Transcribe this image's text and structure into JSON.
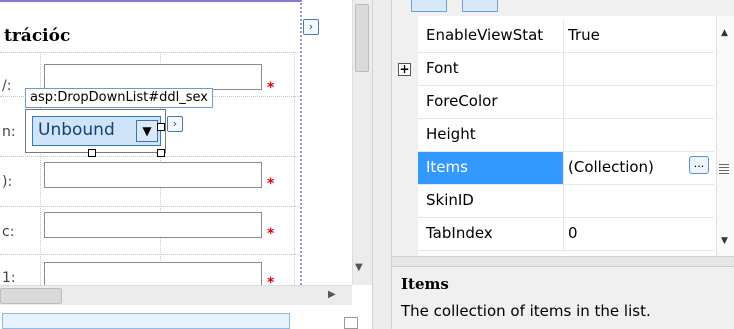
{
  "designer": {
    "page_title": "trációc",
    "row_labels": [
      "/:",
      "n:",
      "):",
      "c:",
      "1:"
    ],
    "required_mark": "*",
    "control_label": "asp:DropDownList#ddl_sex",
    "dropdown_value": "Unbound",
    "dropdown_arrow": "▼",
    "smart_tag_glyph": "›"
  },
  "property_grid": {
    "rows": [
      {
        "name": "EnableViewStat",
        "value": "True"
      },
      {
        "name": "Font",
        "value": "",
        "expand": "+"
      },
      {
        "name": "ForeColor",
        "value": ""
      },
      {
        "name": "Height",
        "value": ""
      },
      {
        "name": "Items",
        "value": "(Collection)",
        "selected": true
      },
      {
        "name": "SkinID",
        "value": ""
      },
      {
        "name": "TabIndex",
        "value": "0"
      }
    ],
    "ellipsis": "...",
    "description_title": "Items",
    "description_text": "The collection of items in the list."
  },
  "colors": {
    "selection": "#3399ff",
    "required": "#e00000",
    "dropdown_fill": "#cfe4f8",
    "page_border": "#8e74d6"
  }
}
